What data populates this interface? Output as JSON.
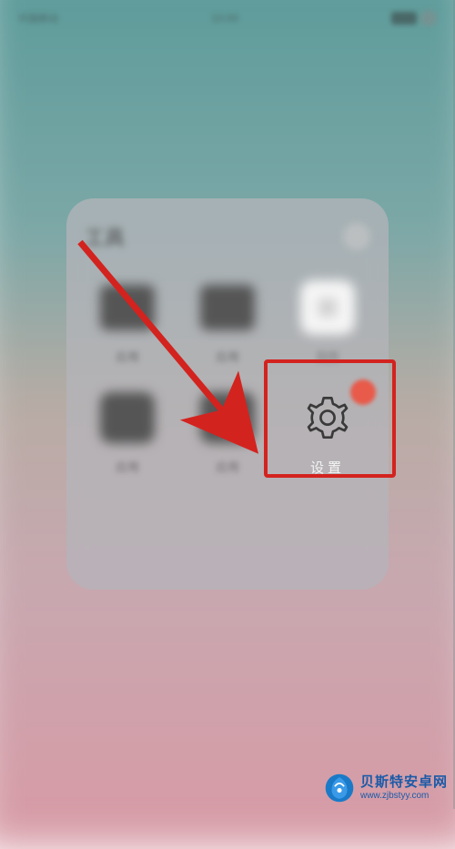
{
  "status": {
    "carrier": "中国移动",
    "time": "10:00"
  },
  "folder": {
    "title": "工具",
    "items": [
      {
        "label": "应用",
        "name": "app-1"
      },
      {
        "label": "应用",
        "name": "app-2"
      },
      {
        "label": "日历",
        "name": "calendar"
      },
      {
        "label": "应用",
        "name": "app-4"
      },
      {
        "label": "应用",
        "name": "app-5"
      },
      {
        "label": "设置",
        "name": "settings"
      }
    ]
  },
  "watermark": {
    "title": "贝斯特安卓网",
    "url": "www.zjbstyy.com"
  }
}
